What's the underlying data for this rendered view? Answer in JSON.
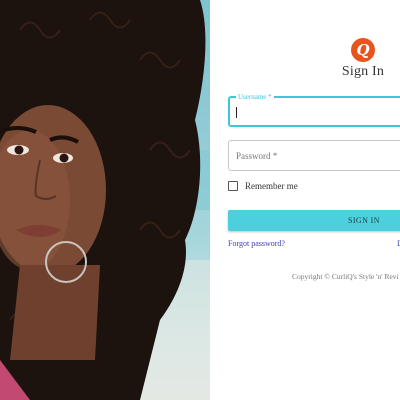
{
  "photo": {
    "description_alt": "woman-portrait"
  },
  "logo": {
    "glyph": "Q",
    "color": "#e8541b"
  },
  "form": {
    "title": "Sign In",
    "username": {
      "label": "Username *",
      "value": ""
    },
    "password": {
      "placeholder": "Password *"
    },
    "remember_label": "Remember me",
    "signin_label": "SIGN IN",
    "forgot_link": "Forgot password?",
    "right_link": "D"
  },
  "footer": {
    "copyright": "Copyright © CurliQ's Style 'n' Revi"
  },
  "colors": {
    "accent": "#4cd0de",
    "focus": "#3fc6d8",
    "link": "#3b3fb0"
  }
}
